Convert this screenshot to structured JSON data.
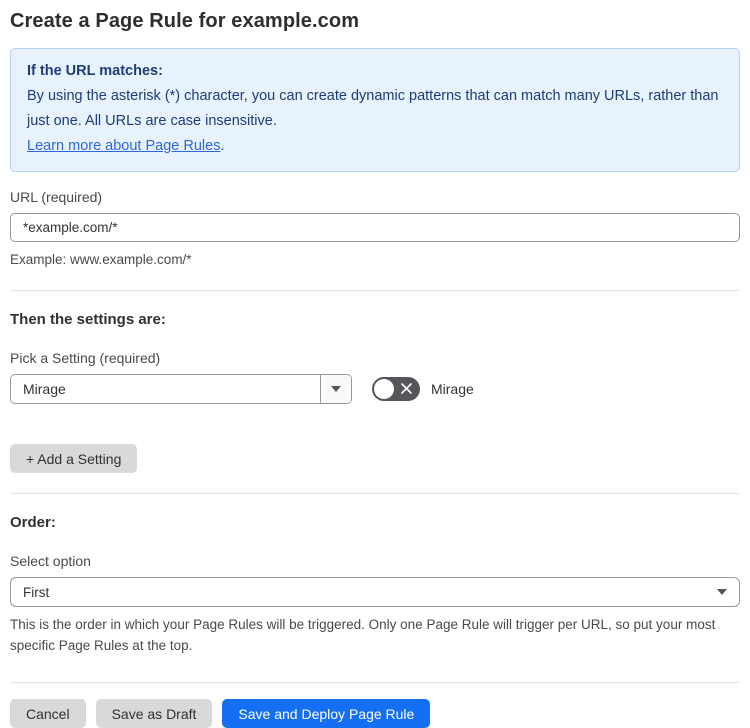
{
  "page": {
    "title": "Create a Page Rule for example.com"
  },
  "info_box": {
    "heading": "If the URL matches:",
    "body": "By using the asterisk (*) character, you can create dynamic patterns that can match many URLs, rather than just one. All URLs are case insensitive.",
    "link_label": "Learn more about Page Rules",
    "link_suffix": "."
  },
  "url_field": {
    "label": "URL (required)",
    "value": "*example.com/*",
    "helper": "Example: www.example.com/*"
  },
  "settings_section": {
    "heading": "Then the settings are:",
    "picker_label": "Pick a Setting (required)",
    "picker_value": "Mirage",
    "toggle": {
      "state": "off",
      "label": "Mirage"
    },
    "add_button_label": "+ Add a Setting"
  },
  "order_section": {
    "heading": "Order:",
    "select_label": "Select option",
    "select_value": "First",
    "helper": "This is the order in which your Page Rules will be triggered. Only one Page Rule will trigger per URL, so put your most specific Page Rules at the top."
  },
  "footer": {
    "cancel_label": "Cancel",
    "save_draft_label": "Save as Draft",
    "save_deploy_label": "Save and Deploy Page Rule"
  },
  "colors": {
    "info_bg": "#e8f2fc",
    "info_border": "#b7d2f0",
    "info_text": "#1d3c78",
    "link_blue": "#2e68d8",
    "primary_button_blue": "#156ff2",
    "gray_button": "#d9d9d9",
    "toggle_off": "#54565a",
    "input_border": "#979797"
  }
}
